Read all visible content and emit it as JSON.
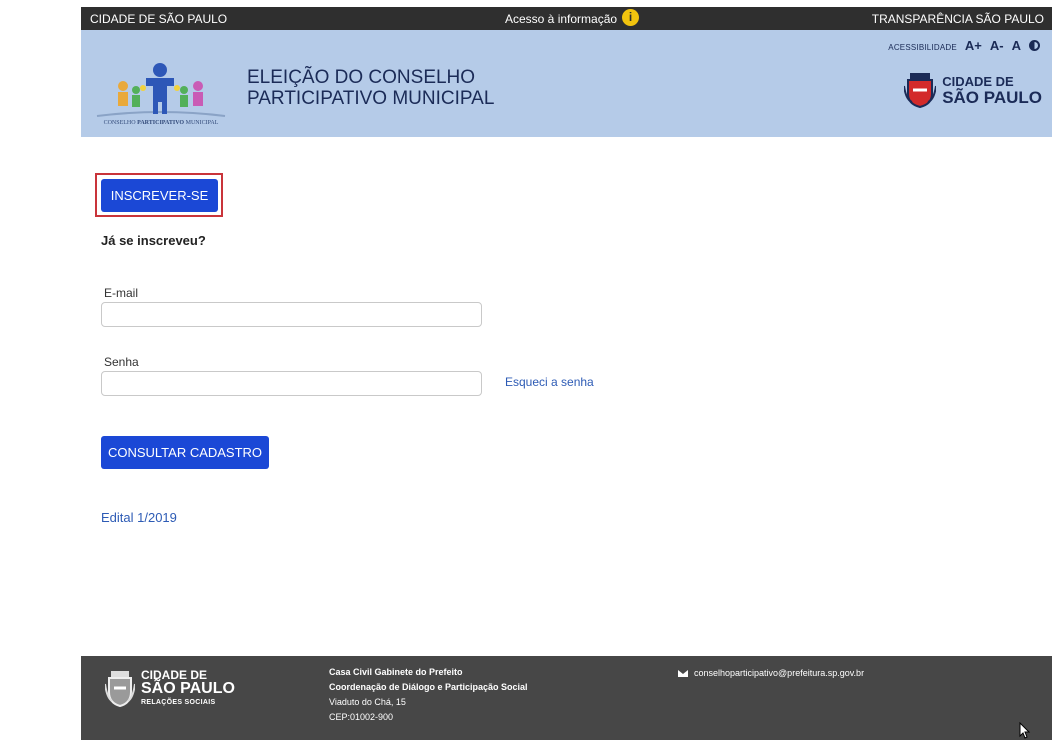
{
  "topbar": {
    "left": "CIDADE DE SÃO PAULO",
    "center": "Acesso à informação",
    "right": "TRANSPARÊNCIA SÃO PAULO"
  },
  "header": {
    "accessibility": {
      "label": "ACESSIBILIDADE",
      "increase": "A+",
      "decrease": "A-",
      "normal": "A"
    },
    "logo_caption_1": "CONSELHO ",
    "logo_caption_2": "PARTICIPATIVO",
    "logo_caption_3": " MUNICIPAL",
    "title_line1": "ELEIÇÃO DO CONSELHO",
    "title_line2": "PARTICIPATIVO MUNICIPAL",
    "city_logo_line1": "CIDADE DE",
    "city_logo_line2": "SÃO PAULO"
  },
  "main": {
    "signup_button": "INSCREVER-SE",
    "already_registered": "Já se inscreveu?",
    "email_label": "E-mail",
    "email_value": "",
    "password_label": "Senha",
    "password_value": "",
    "forgot_link": "Esqueci a senha",
    "consult_button": "CONSULTAR CADASTRO",
    "edital_link": "Edital 1/2019"
  },
  "footer": {
    "logo_line1": "CIDADE DE",
    "logo_line2": "SÃO PAULO",
    "logo_line3": "RELAÇÕES SOCIAIS",
    "address": [
      "Casa Civil Gabinete do Prefeito",
      "Coordenação de Diálogo e Participação Social",
      "Viaduto do Chá, 15",
      "CEP:01002-900"
    ],
    "email": "conselhoparticipativo@prefeitura.sp.gov.br"
  },
  "colors": {
    "header_bg": "#b5cbe8",
    "topbar_bg": "#2f2f2f",
    "button_blue": "#1b48d6",
    "footer_bg": "#474747",
    "highlight_red": "#c9343a",
    "link_blue": "#2d5bb5"
  }
}
